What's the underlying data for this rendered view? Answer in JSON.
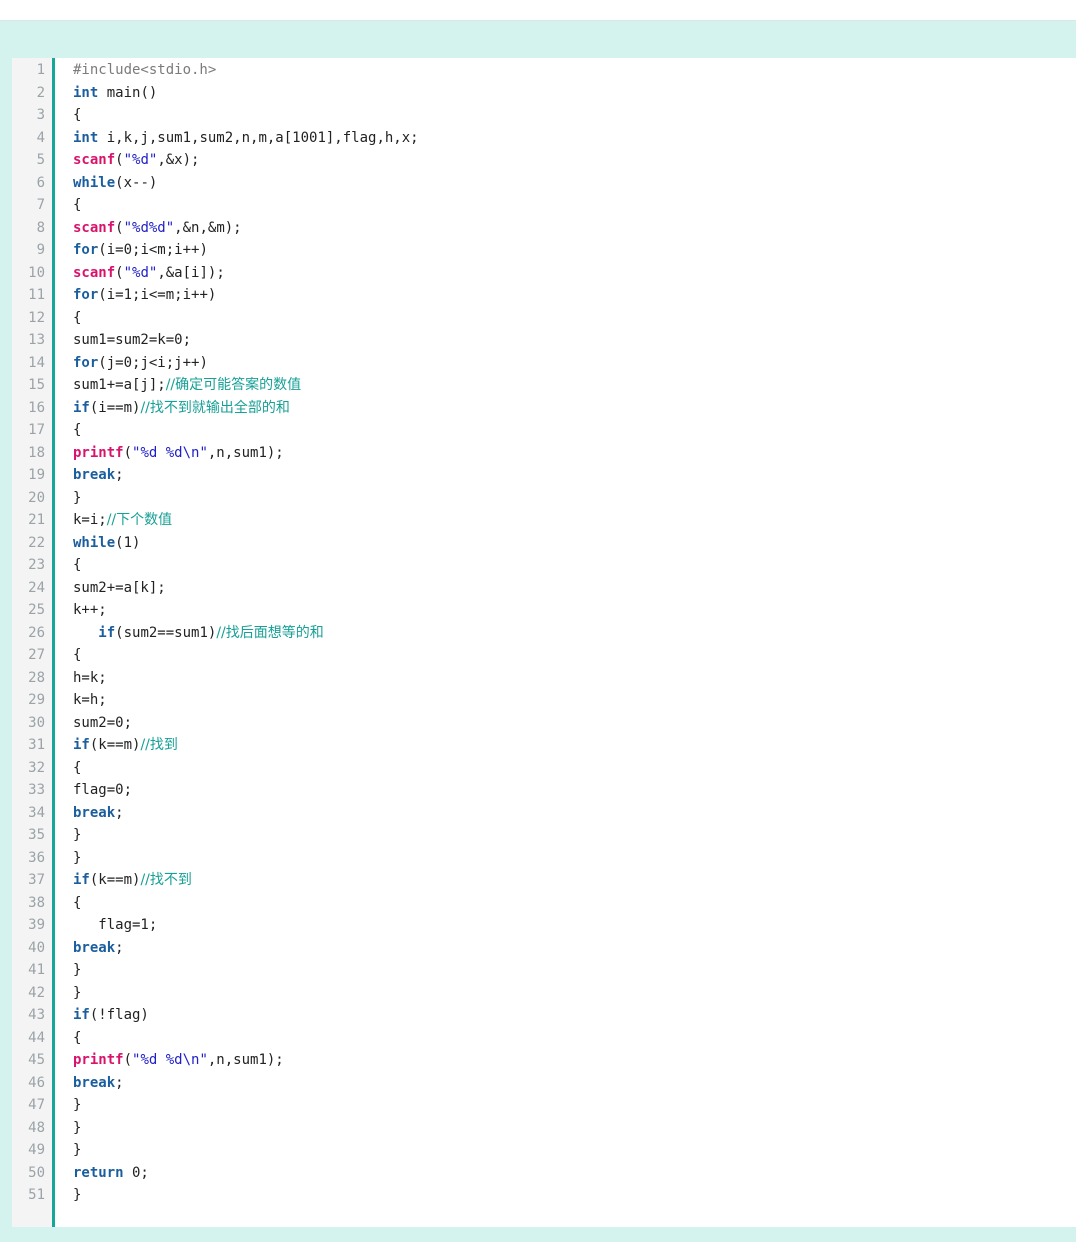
{
  "code": {
    "lines": [
      [
        {
          "t": "pp",
          "v": "#include<stdio.h>"
        }
      ],
      [
        {
          "t": "kw",
          "v": "int"
        },
        {
          "t": "",
          "v": " main()"
        }
      ],
      [
        {
          "t": "",
          "v": "{"
        }
      ],
      [
        {
          "t": "kw",
          "v": "int"
        },
        {
          "t": "",
          "v": " i,k,j,sum1,sum2,n,m,a[1001],flag,h,x;"
        }
      ],
      [
        {
          "t": "fn",
          "v": "scanf"
        },
        {
          "t": "",
          "v": "("
        },
        {
          "t": "str",
          "v": "\"%d\""
        },
        {
          "t": "",
          "v": ",&x);"
        }
      ],
      [
        {
          "t": "kw",
          "v": "while"
        },
        {
          "t": "",
          "v": "(x--)"
        }
      ],
      [
        {
          "t": "",
          "v": "{"
        }
      ],
      [
        {
          "t": "fn",
          "v": "scanf"
        },
        {
          "t": "",
          "v": "("
        },
        {
          "t": "str",
          "v": "\"%d%d\""
        },
        {
          "t": "",
          "v": ",&n,&m);"
        }
      ],
      [
        {
          "t": "kw",
          "v": "for"
        },
        {
          "t": "",
          "v": "(i=0;i<m;i++)"
        }
      ],
      [
        {
          "t": "fn",
          "v": "scanf"
        },
        {
          "t": "",
          "v": "("
        },
        {
          "t": "str",
          "v": "\"%d\""
        },
        {
          "t": "",
          "v": ",&a[i]);"
        }
      ],
      [
        {
          "t": "kw",
          "v": "for"
        },
        {
          "t": "",
          "v": "(i=1;i<=m;i++)"
        }
      ],
      [
        {
          "t": "",
          "v": "{"
        }
      ],
      [
        {
          "t": "",
          "v": "sum1=sum2=k=0;"
        }
      ],
      [
        {
          "t": "kw",
          "v": "for"
        },
        {
          "t": "",
          "v": "(j=0;j<i;j++)"
        }
      ],
      [
        {
          "t": "",
          "v": "sum1+=a[j];"
        },
        {
          "t": "cm",
          "v": "//确定可能答案的数值"
        }
      ],
      [
        {
          "t": "kw",
          "v": "if"
        },
        {
          "t": "",
          "v": "(i==m)"
        },
        {
          "t": "cm",
          "v": "//找不到就输出全部的和"
        }
      ],
      [
        {
          "t": "",
          "v": "{"
        }
      ],
      [
        {
          "t": "fn",
          "v": "printf"
        },
        {
          "t": "",
          "v": "("
        },
        {
          "t": "str",
          "v": "\"%d %d\\n\""
        },
        {
          "t": "",
          "v": ",n,sum1);"
        }
      ],
      [
        {
          "t": "kw",
          "v": "break"
        },
        {
          "t": "",
          "v": ";"
        }
      ],
      [
        {
          "t": "",
          "v": "}"
        }
      ],
      [
        {
          "t": "",
          "v": "k=i;"
        },
        {
          "t": "cm",
          "v": "//下个数值"
        }
      ],
      [
        {
          "t": "kw",
          "v": "while"
        },
        {
          "t": "",
          "v": "(1)"
        }
      ],
      [
        {
          "t": "",
          "v": "{"
        }
      ],
      [
        {
          "t": "",
          "v": "sum2+=a[k];"
        }
      ],
      [
        {
          "t": "",
          "v": "k++;"
        }
      ],
      [
        {
          "t": "",
          "v": "   "
        },
        {
          "t": "kw",
          "v": "if"
        },
        {
          "t": "",
          "v": "(sum2==sum1)"
        },
        {
          "t": "cm",
          "v": "//找后面想等的和"
        }
      ],
      [
        {
          "t": "",
          "v": "{"
        }
      ],
      [
        {
          "t": "",
          "v": "h=k;"
        }
      ],
      [
        {
          "t": "",
          "v": "k=h;"
        }
      ],
      [
        {
          "t": "",
          "v": "sum2=0;"
        }
      ],
      [
        {
          "t": "kw",
          "v": "if"
        },
        {
          "t": "",
          "v": "(k==m)"
        },
        {
          "t": "cm",
          "v": "//找到"
        }
      ],
      [
        {
          "t": "",
          "v": "{"
        }
      ],
      [
        {
          "t": "",
          "v": "flag=0;"
        }
      ],
      [
        {
          "t": "kw",
          "v": "break"
        },
        {
          "t": "",
          "v": ";"
        }
      ],
      [
        {
          "t": "",
          "v": "}"
        }
      ],
      [
        {
          "t": "",
          "v": "}"
        }
      ],
      [
        {
          "t": "kw",
          "v": "if"
        },
        {
          "t": "",
          "v": "(k==m)"
        },
        {
          "t": "cm",
          "v": "//找不到"
        }
      ],
      [
        {
          "t": "",
          "v": "{"
        }
      ],
      [
        {
          "t": "",
          "v": "   flag=1;"
        }
      ],
      [
        {
          "t": "kw",
          "v": "break"
        },
        {
          "t": "",
          "v": ";"
        }
      ],
      [
        {
          "t": "",
          "v": "}"
        }
      ],
      [
        {
          "t": "",
          "v": "}"
        }
      ],
      [
        {
          "t": "kw",
          "v": "if"
        },
        {
          "t": "",
          "v": "(!flag)"
        }
      ],
      [
        {
          "t": "",
          "v": "{"
        }
      ],
      [
        {
          "t": "fn",
          "v": "printf"
        },
        {
          "t": "",
          "v": "("
        },
        {
          "t": "str",
          "v": "\"%d %d\\n\""
        },
        {
          "t": "",
          "v": ",n,sum1);"
        }
      ],
      [
        {
          "t": "kw",
          "v": "break"
        },
        {
          "t": "",
          "v": ";"
        }
      ],
      [
        {
          "t": "",
          "v": "}"
        }
      ],
      [
        {
          "t": "",
          "v": "}"
        }
      ],
      [
        {
          "t": "",
          "v": "}"
        }
      ],
      [
        {
          "t": "kw",
          "v": "return"
        },
        {
          "t": "",
          "v": " 0;"
        }
      ],
      [
        {
          "t": "",
          "v": "}"
        }
      ]
    ]
  }
}
